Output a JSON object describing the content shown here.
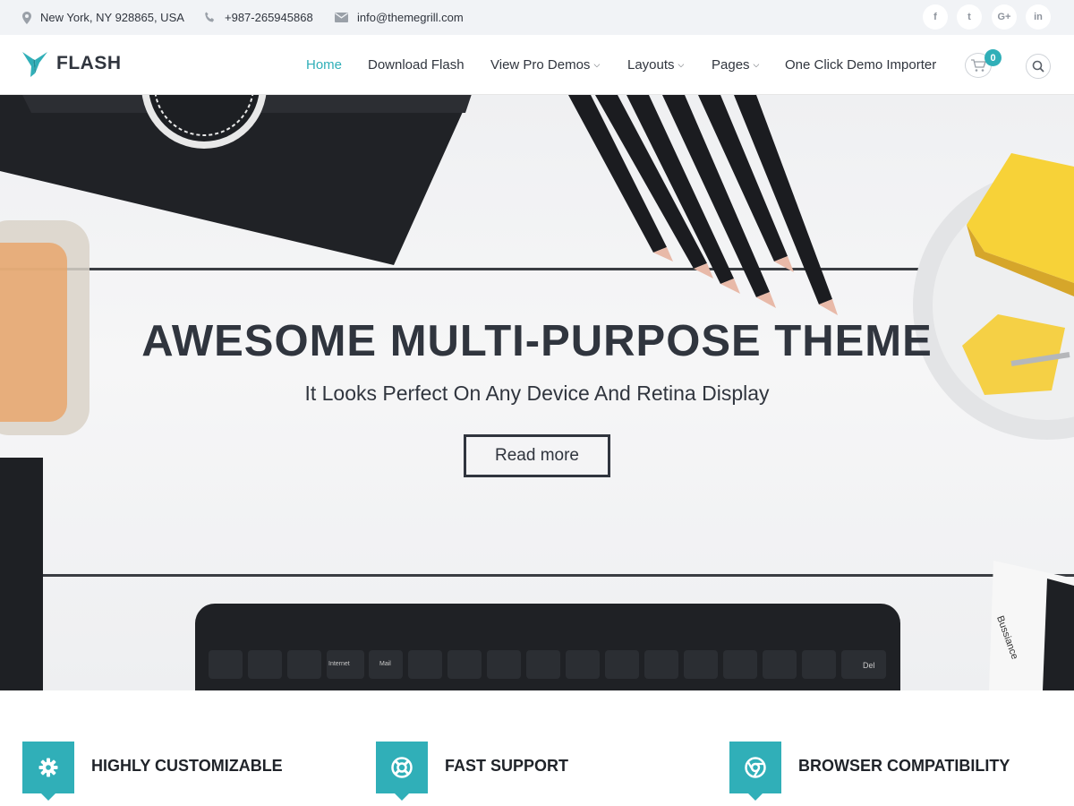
{
  "topbar": {
    "address": "New York, NY 928865, USA",
    "phone": "+987-265945868",
    "email": "info@themegrill.com",
    "social": [
      {
        "icon": "facebook-icon",
        "glyph": "f"
      },
      {
        "icon": "twitter-icon",
        "glyph": "t"
      },
      {
        "icon": "google-plus-icon",
        "glyph": "G+"
      },
      {
        "icon": "linkedin-icon",
        "glyph": "in"
      }
    ]
  },
  "header": {
    "logo_text": "FLASH",
    "nav": [
      {
        "label": "Home",
        "active": true
      },
      {
        "label": "Download Flash"
      },
      {
        "label": "View Pro Demos",
        "dropdown": true
      },
      {
        "label": "Layouts",
        "dropdown": true
      },
      {
        "label": "Pages",
        "dropdown": true
      },
      {
        "label": "One Click Demo Importer"
      }
    ],
    "cart_count": "0"
  },
  "hero": {
    "title": "AWESOME MULTI-PURPOSE THEME",
    "subtitle": "It Looks Perfect On Any Device And Retina Display",
    "button": "Read more",
    "keyboard_keys": [
      "Internet",
      "Mail",
      "Del"
    ],
    "box_text": "Bussiance"
  },
  "features": [
    {
      "title": "HIGHLY CUSTOMIZABLE",
      "icon": "gear-icon"
    },
    {
      "title": "FAST SUPPORT",
      "icon": "lifebuoy-icon"
    },
    {
      "title": "BROWSER COMPATIBILITY",
      "icon": "chrome-icon"
    }
  ],
  "colors": {
    "accent": "#30afb8",
    "dark_text": "#30353e",
    "topbar_bg": "#f1f3f6"
  }
}
